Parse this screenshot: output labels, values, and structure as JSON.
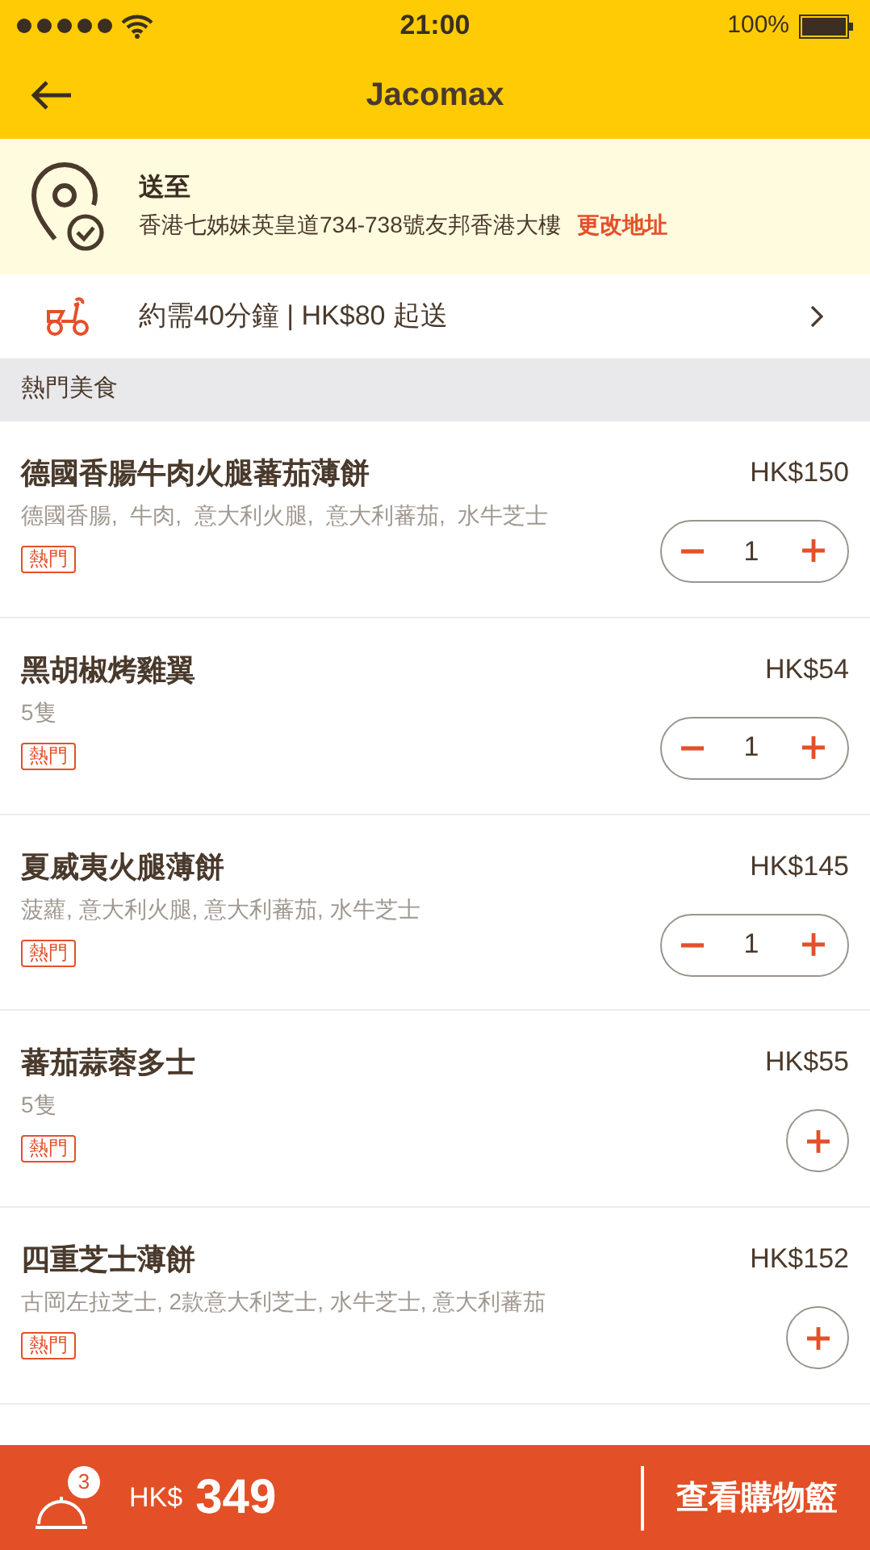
{
  "status_bar": {
    "time": "21:00",
    "battery": "100%"
  },
  "header": {
    "title": "Jacomax"
  },
  "address": {
    "label": "送至",
    "text": "香港七姊妹英皇道734-738號友邦香港大樓",
    "change_link": "更改地址"
  },
  "delivery": {
    "text": "約需40分鐘 | HK$80 起送"
  },
  "section": {
    "title": "熱門美食"
  },
  "items": [
    {
      "name": "德國香腸牛肉火腿蕃茄薄餅",
      "price": "HK$150",
      "description": "德國香腸,  牛肉,  意大利火腿,  意大利蕃茄,  水牛芝士",
      "tag": "熱門",
      "kind": "stepper",
      "quantity": "1"
    },
    {
      "name": "黑胡椒烤雞翼",
      "price": "HK$54",
      "description": "5隻",
      "tag": "熱門",
      "kind": "stepper",
      "quantity": "1"
    },
    {
      "name": "夏威夷火腿薄餅",
      "price": "HK$145",
      "description": "菠蘿, 意大利火腿, 意大利蕃茄, 水牛芝士",
      "tag": "熱門",
      "kind": "stepper",
      "quantity": "1"
    },
    {
      "name": "蕃茄蒜蓉多士",
      "price": "HK$55",
      "description": "5隻",
      "tag": "熱門",
      "kind": "add"
    },
    {
      "name": "四重芝士薄餅",
      "price": "HK$152",
      "description": "古岡左拉芝士, 2款意大利芝士, 水牛芝士, 意大利蕃茄",
      "tag": "熱門",
      "kind": "add"
    }
  ],
  "cart": {
    "count": "3",
    "currency": "HK$",
    "total": "349",
    "button": "查看購物籃"
  }
}
